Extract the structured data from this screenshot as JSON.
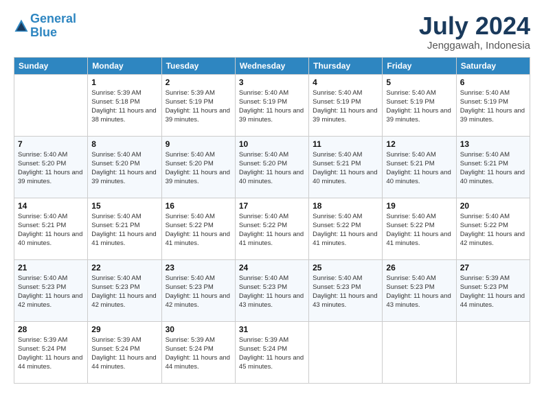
{
  "header": {
    "logo_line1": "General",
    "logo_line2": "Blue",
    "month_title": "July 2024",
    "location": "Jenggawah, Indonesia"
  },
  "weekdays": [
    "Sunday",
    "Monday",
    "Tuesday",
    "Wednesday",
    "Thursday",
    "Friday",
    "Saturday"
  ],
  "weeks": [
    [
      {
        "day": "",
        "info": ""
      },
      {
        "day": "1",
        "info": "Sunrise: 5:39 AM\nSunset: 5:18 PM\nDaylight: 11 hours and 38 minutes."
      },
      {
        "day": "2",
        "info": "Sunrise: 5:39 AM\nSunset: 5:19 PM\nDaylight: 11 hours and 39 minutes."
      },
      {
        "day": "3",
        "info": "Sunrise: 5:40 AM\nSunset: 5:19 PM\nDaylight: 11 hours and 39 minutes."
      },
      {
        "day": "4",
        "info": "Sunrise: 5:40 AM\nSunset: 5:19 PM\nDaylight: 11 hours and 39 minutes."
      },
      {
        "day": "5",
        "info": "Sunrise: 5:40 AM\nSunset: 5:19 PM\nDaylight: 11 hours and 39 minutes."
      },
      {
        "day": "6",
        "info": "Sunrise: 5:40 AM\nSunset: 5:19 PM\nDaylight: 11 hours and 39 minutes."
      }
    ],
    [
      {
        "day": "7",
        "info": "Sunrise: 5:40 AM\nSunset: 5:20 PM\nDaylight: 11 hours and 39 minutes."
      },
      {
        "day": "8",
        "info": "Sunrise: 5:40 AM\nSunset: 5:20 PM\nDaylight: 11 hours and 39 minutes."
      },
      {
        "day": "9",
        "info": "Sunrise: 5:40 AM\nSunset: 5:20 PM\nDaylight: 11 hours and 39 minutes."
      },
      {
        "day": "10",
        "info": "Sunrise: 5:40 AM\nSunset: 5:20 PM\nDaylight: 11 hours and 40 minutes."
      },
      {
        "day": "11",
        "info": "Sunrise: 5:40 AM\nSunset: 5:21 PM\nDaylight: 11 hours and 40 minutes."
      },
      {
        "day": "12",
        "info": "Sunrise: 5:40 AM\nSunset: 5:21 PM\nDaylight: 11 hours and 40 minutes."
      },
      {
        "day": "13",
        "info": "Sunrise: 5:40 AM\nSunset: 5:21 PM\nDaylight: 11 hours and 40 minutes."
      }
    ],
    [
      {
        "day": "14",
        "info": "Sunrise: 5:40 AM\nSunset: 5:21 PM\nDaylight: 11 hours and 40 minutes."
      },
      {
        "day": "15",
        "info": "Sunrise: 5:40 AM\nSunset: 5:21 PM\nDaylight: 11 hours and 41 minutes."
      },
      {
        "day": "16",
        "info": "Sunrise: 5:40 AM\nSunset: 5:22 PM\nDaylight: 11 hours and 41 minutes."
      },
      {
        "day": "17",
        "info": "Sunrise: 5:40 AM\nSunset: 5:22 PM\nDaylight: 11 hours and 41 minutes."
      },
      {
        "day": "18",
        "info": "Sunrise: 5:40 AM\nSunset: 5:22 PM\nDaylight: 11 hours and 41 minutes."
      },
      {
        "day": "19",
        "info": "Sunrise: 5:40 AM\nSunset: 5:22 PM\nDaylight: 11 hours and 41 minutes."
      },
      {
        "day": "20",
        "info": "Sunrise: 5:40 AM\nSunset: 5:22 PM\nDaylight: 11 hours and 42 minutes."
      }
    ],
    [
      {
        "day": "21",
        "info": "Sunrise: 5:40 AM\nSunset: 5:23 PM\nDaylight: 11 hours and 42 minutes."
      },
      {
        "day": "22",
        "info": "Sunrise: 5:40 AM\nSunset: 5:23 PM\nDaylight: 11 hours and 42 minutes."
      },
      {
        "day": "23",
        "info": "Sunrise: 5:40 AM\nSunset: 5:23 PM\nDaylight: 11 hours and 42 minutes."
      },
      {
        "day": "24",
        "info": "Sunrise: 5:40 AM\nSunset: 5:23 PM\nDaylight: 11 hours and 43 minutes."
      },
      {
        "day": "25",
        "info": "Sunrise: 5:40 AM\nSunset: 5:23 PM\nDaylight: 11 hours and 43 minutes."
      },
      {
        "day": "26",
        "info": "Sunrise: 5:40 AM\nSunset: 5:23 PM\nDaylight: 11 hours and 43 minutes."
      },
      {
        "day": "27",
        "info": "Sunrise: 5:39 AM\nSunset: 5:23 PM\nDaylight: 11 hours and 44 minutes."
      }
    ],
    [
      {
        "day": "28",
        "info": "Sunrise: 5:39 AM\nSunset: 5:24 PM\nDaylight: 11 hours and 44 minutes."
      },
      {
        "day": "29",
        "info": "Sunrise: 5:39 AM\nSunset: 5:24 PM\nDaylight: 11 hours and 44 minutes."
      },
      {
        "day": "30",
        "info": "Sunrise: 5:39 AM\nSunset: 5:24 PM\nDaylight: 11 hours and 44 minutes."
      },
      {
        "day": "31",
        "info": "Sunrise: 5:39 AM\nSunset: 5:24 PM\nDaylight: 11 hours and 45 minutes."
      },
      {
        "day": "",
        "info": ""
      },
      {
        "day": "",
        "info": ""
      },
      {
        "day": "",
        "info": ""
      }
    ]
  ]
}
